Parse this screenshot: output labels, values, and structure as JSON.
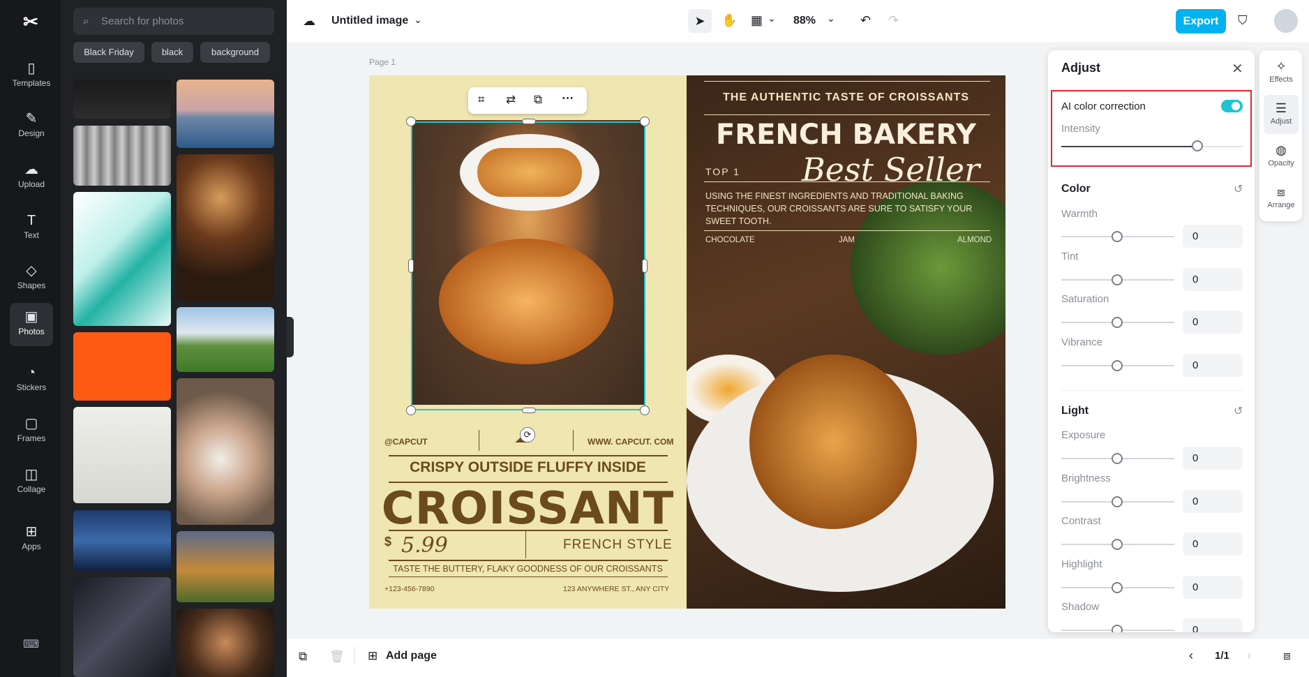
{
  "app": {
    "title": "Untitled image",
    "zoom": "88%",
    "export_label": "Export",
    "logo": "capcut-logo"
  },
  "nav": {
    "items": [
      {
        "label": "Templates",
        "icon": "templates-icon"
      },
      {
        "label": "Design",
        "icon": "design-icon"
      },
      {
        "label": "Upload",
        "icon": "upload-icon"
      },
      {
        "label": "Text",
        "icon": "text-icon"
      },
      {
        "label": "Shapes",
        "icon": "shapes-icon"
      },
      {
        "label": "Photos",
        "icon": "photos-icon"
      },
      {
        "label": "Stickers",
        "icon": "stickers-icon"
      },
      {
        "label": "Frames",
        "icon": "frames-icon"
      },
      {
        "label": "Collage",
        "icon": "collage-icon"
      },
      {
        "label": "Apps",
        "icon": "apps-icon"
      }
    ],
    "active": "Photos"
  },
  "photos_panel": {
    "search_placeholder": "Search for photos",
    "chips": [
      "Black Friday",
      "black",
      "background"
    ]
  },
  "canvas": {
    "page_label": "Page 1"
  },
  "design": {
    "handle": "@CAPCUT",
    "website": "WWW. CAPCUT. COM",
    "subheading": "CRISPY OUTSIDE FLUFFY INSIDE",
    "title": "CROISSANT",
    "currency": "$",
    "price": "5.99",
    "style": "FRENCH STYLE",
    "tagline": "TASTE THE BUTTERY, FLAKY GOODNESS OF OUR CROISSANTS",
    "phone": "+123-456-7890",
    "address": "123 ANYWHERE ST., ANY CITY",
    "right_top": "THE AUTHENTIC TASTE OF CROISSANTS",
    "right_title": "FRENCH BAKERY",
    "right_script": "Best Seller",
    "top_label": "TOP 1",
    "description": "USING THE FINEST INGREDIENTS AND TRADITIONAL BAKING TECHNIQUES, OUR CROISSANTS ARE SURE TO SATISFY YOUR SWEET TOOTH.",
    "flavors": [
      "CHOCOLATE",
      "JAM",
      "ALMOND"
    ]
  },
  "adjust": {
    "title": "Adjust",
    "ai_label": "AI color correction",
    "ai_enabled": true,
    "intensity_label": "Intensity",
    "intensity_level": 0.75,
    "color_header": "Color",
    "color_sliders": [
      {
        "label": "Warmth",
        "value": "0"
      },
      {
        "label": "Tint",
        "value": "0"
      },
      {
        "label": "Saturation",
        "value": "0"
      },
      {
        "label": "Vibrance",
        "value": "0"
      }
    ],
    "light_header": "Light",
    "light_sliders": [
      {
        "label": "Exposure",
        "value": "0"
      },
      {
        "label": "Brightness",
        "value": "0"
      },
      {
        "label": "Contrast",
        "value": "0"
      },
      {
        "label": "Highlight",
        "value": "0"
      },
      {
        "label": "Shadow",
        "value": "0"
      }
    ]
  },
  "right_tabs": [
    {
      "label": "Effects",
      "icon": "effects-icon"
    },
    {
      "label": "Adjust",
      "icon": "adjust-icon"
    },
    {
      "label": "Opacity",
      "icon": "opacity-icon"
    },
    {
      "label": "Arrange",
      "icon": "arrange-icon"
    }
  ],
  "bottom": {
    "add_page": "Add page",
    "page_indicator": "1/1"
  },
  "colors": {
    "accent": "#00b2f0",
    "toggle": "#1ec4d0",
    "highlight_border": "#e0262d",
    "cream": "#efe6b2",
    "brown": "#6b4a1e"
  }
}
